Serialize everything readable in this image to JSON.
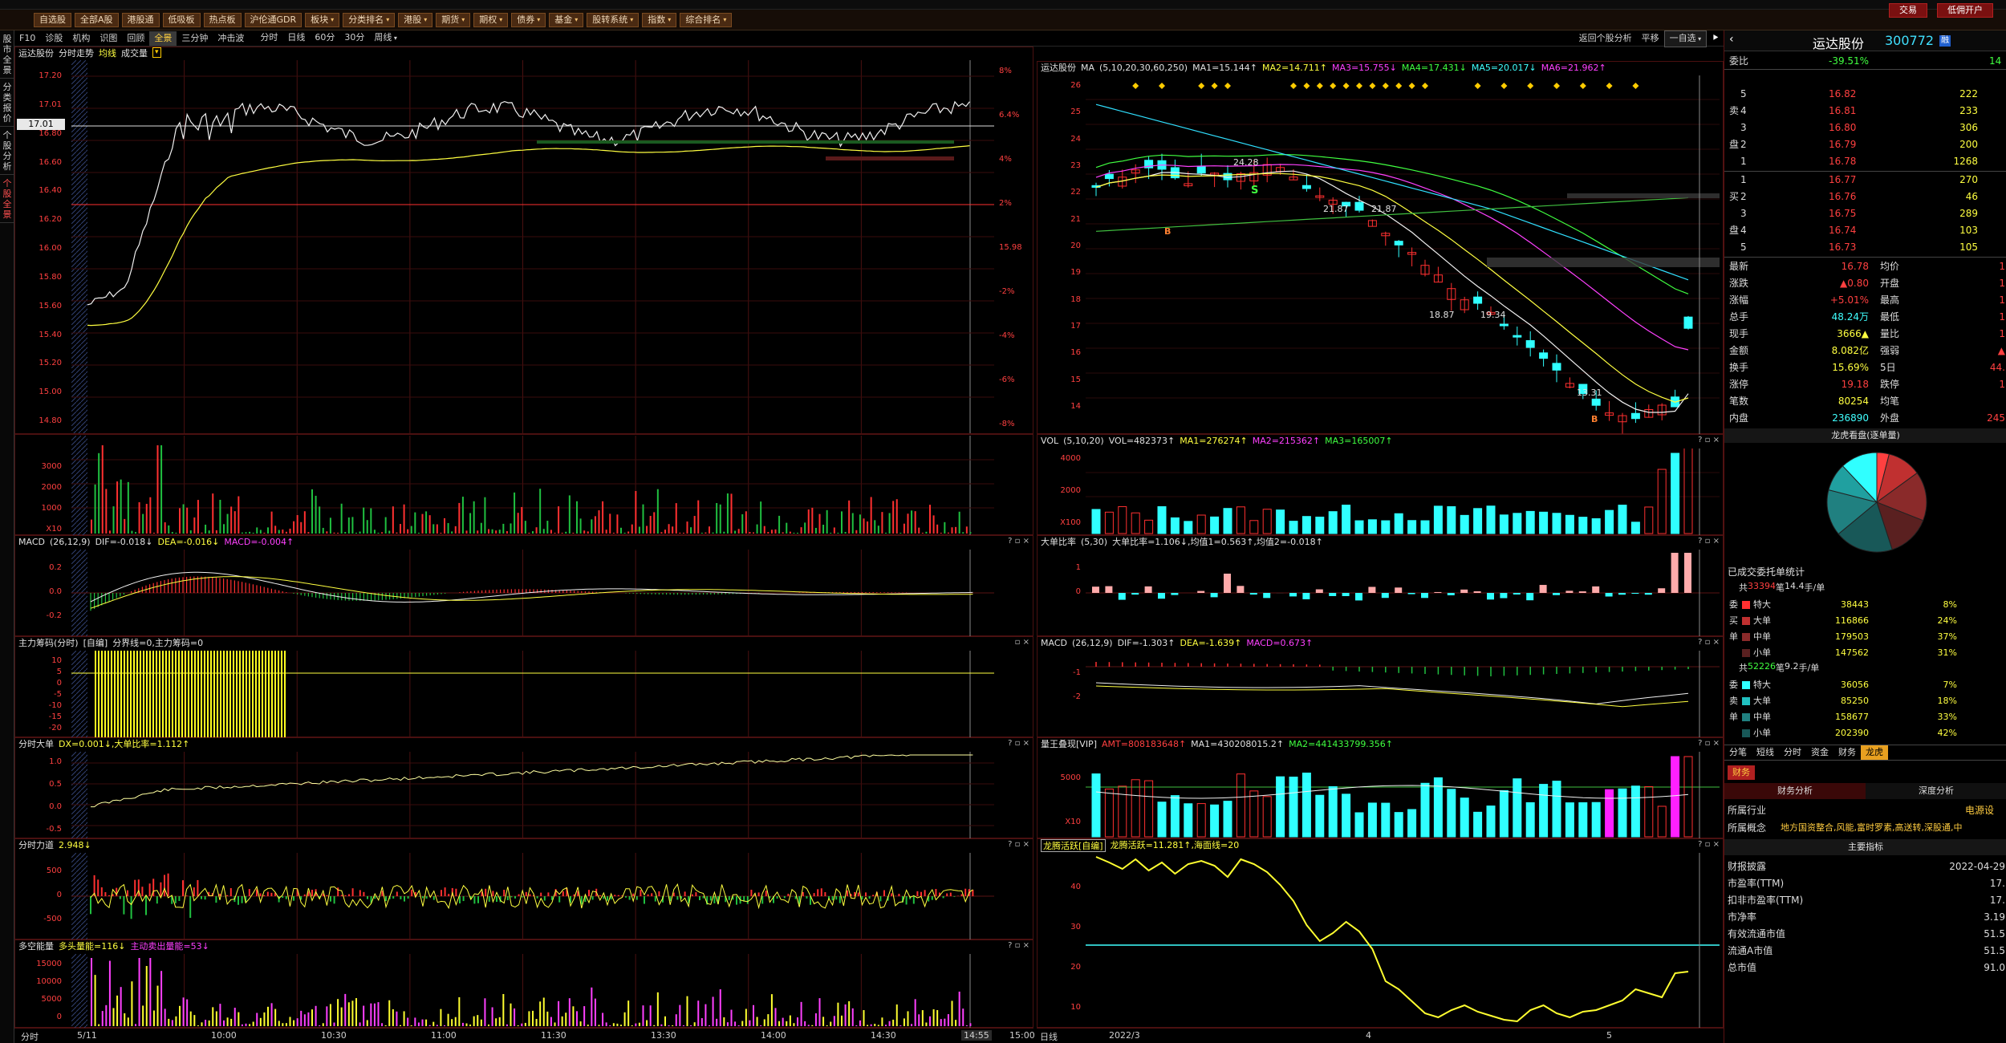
{
  "toolbar": {
    "left_buttons": [
      "自选股",
      "全部A股",
      "港股通",
      "低吸板",
      "热点板",
      "沪伦通GDR",
      "板块",
      "分类排名",
      "港股",
      "期货",
      "期权",
      "债券",
      "基金",
      "股转系统",
      "指数",
      "综合排名"
    ],
    "dropdown_flags": [
      false,
      false,
      false,
      false,
      false,
      false,
      true,
      true,
      true,
      true,
      true,
      true,
      true,
      true,
      true,
      true
    ],
    "right_buttons": [
      "交易",
      "低佣开户"
    ]
  },
  "left_nav": [
    "股市全景",
    "分类报价",
    "个股分析",
    "个股全景"
  ],
  "tabbar": {
    "left_tabs": [
      "F10",
      "诊股",
      "机构",
      "识图",
      "回顾",
      "全景",
      "三分钟",
      "冲击波"
    ],
    "active_tab": "全景",
    "period_tabs": [
      "分时",
      "日线",
      "60分",
      "30分",
      "周线"
    ],
    "right_items": [
      "返回个股分析",
      "平移",
      "一自选"
    ]
  },
  "intraday": {
    "header": {
      "name": "运达股份",
      "items": [
        "分时走势",
        "均线",
        "成交量"
      ]
    },
    "price_labels": [
      "17.20",
      "17.01",
      "16.80",
      "16.60",
      "16.40",
      "16.20",
      "16.00",
      "15.80",
      "15.60",
      "15.40",
      "15.20",
      "15.00",
      "14.80"
    ],
    "current_price_tag": "17.01",
    "pct_labels": [
      "8%",
      "6.4%",
      "4%",
      "2%",
      "15.98",
      "-2%",
      "-4%",
      "-6%",
      "-8%"
    ],
    "vol_labels": [
      "3000",
      "2000",
      "1000",
      "X10"
    ],
    "macd": {
      "title": "MACD",
      "params": "(26,12,9)",
      "dif": "DIF=-0.018↓",
      "dea": "DEA=-0.016↓",
      "macd": "MACD=-0.004↑",
      "labels": [
        "0.2",
        "0.0",
        "-0.2"
      ]
    },
    "chips": {
      "title": "主力筹码(分时)",
      "extra": "[自编]",
      "line": "分界线=0,主力筹码=0",
      "labels": [
        "10",
        "5",
        "0",
        "-5",
        "-10",
        "-15",
        "-20"
      ]
    },
    "dx": {
      "title": "分时大单",
      "vals": "DX=0.001↓,大单比率=1.112↑",
      "labels": [
        "1.0",
        "0.5",
        "0.0",
        "-0.5"
      ]
    },
    "force": {
      "title": "分时力道",
      "val": "2.948↓",
      "labels": [
        "500",
        "0",
        "-500"
      ]
    },
    "energy": {
      "title": "多空能量",
      "v1": "多头量能=116↓",
      "v2": "主动卖出量能=53↓",
      "labels": [
        "15000",
        "10000",
        "5000",
        "0"
      ]
    },
    "xaxis": {
      "start": "5/11",
      "ticks": [
        "10:00",
        "10:30",
        "11:00",
        "11:30",
        "13:30",
        "14:00",
        "14:30",
        "14:55",
        "15:00"
      ],
      "left": "分时"
    }
  },
  "daily": {
    "header": {
      "name": "运达股份",
      "ma": "MA",
      "params": "(5,10,20,30,60,250)",
      "ma1": "MA1=15.144↑",
      "ma2": "MA2=14.711↑",
      "ma3": "MA3=15.755↓",
      "ma4": "MA4=17.431↓",
      "ma5": "MA5=20.017↓",
      "ma6": "MA6=21.962↑"
    },
    "price_labels": [
      "26",
      "25",
      "24",
      "23",
      "22",
      "21",
      "20",
      "19",
      "18",
      "17",
      "16",
      "15",
      "14"
    ],
    "annotations": [
      "24.28",
      "21.87",
      "21.87",
      "18.87",
      "19.34",
      "13.31"
    ],
    "vol": {
      "title": "VOL",
      "params": "(5,10,20)",
      "vals": [
        "VOL=482373↑",
        "MA1=276274↑",
        "MA2=215362↑",
        "MA3=165007↑"
      ],
      "labels": [
        "4000",
        "2000",
        "X100"
      ]
    },
    "bigratio": {
      "title": "大单比率",
      "params": "(5,30)",
      "vals": "大单比率=1.106↓,均值1=0.563↑,均值2=-0.018↑",
      "labels": [
        "1",
        "0"
      ]
    },
    "macd": {
      "title": "MACD",
      "params": "(26,12,9)",
      "vals": [
        "DIF=-1.303↑",
        "DEA=-1.639↑",
        "MACD=0.673↑"
      ],
      "labels": [
        "-1",
        "-2"
      ]
    },
    "liang": {
      "title": "量王叠现[VIP]",
      "vals": [
        "AMT=808183648↑",
        "MA1=430208015.2↑",
        "MA2=441433799.356↑"
      ],
      "labels": [
        "5000",
        "X10"
      ]
    },
    "dragon": {
      "title": "龙腾活跃[自编]",
      "vals": "龙腾活跃=11.281↑,海面线=20",
      "labels": [
        "40",
        "30",
        "20",
        "10"
      ]
    },
    "xaxis": {
      "left": "日线",
      "ticks": [
        "2022/3",
        "4",
        "5"
      ]
    }
  },
  "right": {
    "stock_name": "运达股份",
    "code": "300772",
    "weibi": {
      "label": "委比",
      "pct": "-39.51%",
      "num": "14"
    },
    "sells": [
      {
        "side": "",
        "lvl": "5",
        "price": "16.82",
        "vol": "222"
      },
      {
        "side": "卖",
        "lvl": "4",
        "price": "16.81",
        "vol": "233"
      },
      {
        "side": "",
        "lvl": "3",
        "price": "16.80",
        "vol": "306"
      },
      {
        "side": "盘",
        "lvl": "2",
        "price": "16.79",
        "vol": "200"
      },
      {
        "side": "",
        "lvl": "1",
        "price": "16.78",
        "vol": "1268"
      }
    ],
    "buys": [
      {
        "side": "",
        "lvl": "1",
        "price": "16.77",
        "vol": "270"
      },
      {
        "side": "买",
        "lvl": "2",
        "price": "16.76",
        "vol": "46"
      },
      {
        "side": "",
        "lvl": "3",
        "price": "16.75",
        "vol": "289"
      },
      {
        "side": "盘",
        "lvl": "4",
        "price": "16.74",
        "vol": "103"
      },
      {
        "side": "",
        "lvl": "5",
        "price": "16.73",
        "vol": "105"
      }
    ],
    "quotes": [
      {
        "k1": "最新",
        "v1": "16.78",
        "k2": "均价",
        "v2": "1"
      },
      {
        "k1": "涨跌",
        "v1": "▲0.80",
        "k2": "开盘",
        "v2": "1"
      },
      {
        "k1": "涨幅",
        "v1": "+5.01%",
        "k2": "最高",
        "v2": "1"
      },
      {
        "k1": "总手",
        "v1": "48.24万",
        "k2": "最低",
        "v2": "1"
      },
      {
        "k1": "现手",
        "v1": "3666▲",
        "k2": "量比",
        "v2": "1"
      },
      {
        "k1": "金额",
        "v1": "8.082亿",
        "k2": "强弱",
        "v2": "▲"
      },
      {
        "k1": "换手",
        "v1": "15.69%",
        "k2": "5日",
        "v2": "44."
      },
      {
        "k1": "涨停",
        "v1": "19.18",
        "k2": "跌停",
        "v2": "1"
      },
      {
        "k1": "笔数",
        "v1": "80254",
        "k2": "均笔",
        "v2": ""
      },
      {
        "k1": "内盘",
        "v1": "236890",
        "k2": "外盘",
        "v2": "245"
      }
    ],
    "pie_title": "龙虎看盘(逐单量)",
    "deal_title": "已成交委托单统计",
    "buy_stat": {
      "head_pre": "共",
      "count": "33394",
      "head_mid": "笔",
      "avg": "14.4",
      "head_post": "手/单",
      "rows": [
        {
          "side": "委",
          "name": "特大",
          "vol": "38443",
          "pct": "8%",
          "color": "#ff3030"
        },
        {
          "side": "买",
          "name": "大单",
          "vol": "116866",
          "pct": "24%",
          "color": "#c03030"
        },
        {
          "side": "单",
          "name": "中单",
          "vol": "179503",
          "pct": "37%",
          "color": "#8a2a2a"
        },
        {
          "side": "",
          "name": "小单",
          "vol": "147562",
          "pct": "31%",
          "color": "#5a2020"
        }
      ]
    },
    "sell_stat": {
      "head_pre": "共",
      "count": "52226",
      "head_mid": "笔",
      "avg": "9.2",
      "head_post": "手/单",
      "rows": [
        {
          "side": "委",
          "name": "特大",
          "vol": "36056",
          "pct": "7%",
          "color": "#30ffff"
        },
        {
          "side": "卖",
          "name": "大单",
          "vol": "85250",
          "pct": "18%",
          "color": "#20c0c0"
        },
        {
          "side": "单",
          "name": "中单",
          "vol": "158677",
          "pct": "33%",
          "color": "#208080"
        },
        {
          "side": "",
          "name": "小单",
          "vol": "202390",
          "pct": "42%",
          "color": "#185858"
        }
      ]
    },
    "bottom_tabs": [
      "分笔",
      "短线",
      "分时",
      "资金",
      "财务",
      "龙虎"
    ],
    "active_bottom_tab": "龙虎",
    "fin_tab": "财务",
    "fin_subtabs": [
      "财务分析",
      "深度分析"
    ],
    "industry": {
      "label": "所属行业",
      "value": "电源设"
    },
    "concept": {
      "label": "所属概念",
      "value": "地方国资整合,风能,富时罗素,高送转,深股通,中"
    },
    "main_title": "主要指标",
    "fin_rows": [
      {
        "k": "财报披露",
        "v": "2022-04-29"
      },
      {
        "k": "市盈率(TTM)",
        "v": "17."
      },
      {
        "k": "扣非市盈率(TTM)",
        "v": "17."
      },
      {
        "k": "市净率",
        "v": "3.19"
      },
      {
        "k": "有效流通市值",
        "v": "51.5"
      },
      {
        "k": "流通A市值",
        "v": "51.5"
      },
      {
        "k": "总市值",
        "v": "91.0"
      }
    ]
  }
}
